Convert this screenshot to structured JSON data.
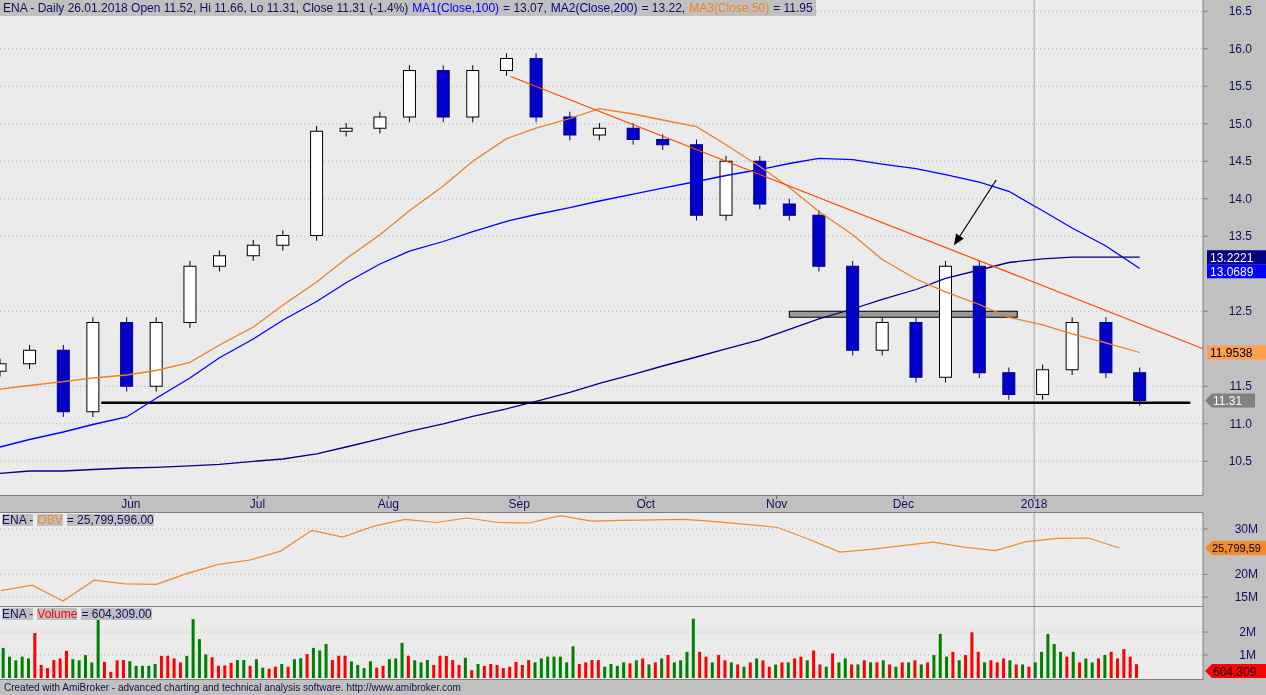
{
  "main": {
    "title": "ENA - Daily 26.01.2018 Open 11.52, Hi 11.66, Lo 11.31, Close 11.31 (-1.4%)",
    "readings": [
      "= 13.07,",
      "= 13.22,",
      "= 11.95"
    ],
    "value_tags": [
      {
        "text": "13.2221",
        "kind": "box",
        "color": "#000080"
      },
      {
        "text": "13.0689",
        "kind": "box",
        "color": "#0000ff"
      },
      {
        "text": "11.9538",
        "kind": "box",
        "color": "#ffa050"
      },
      {
        "text": "11.31",
        "kind": "arrow",
        "color": "#808080"
      }
    ],
    "chart_data": {
      "type": "candlestick",
      "grid": true,
      "ref_lines": [
        {
          "axis": "x",
          "value": "2018-01-01"
        },
        {
          "axis": "y",
          "value": 11.28
        }
      ],
      "bands": [
        {
          "axis": "y",
          "from": 12.42,
          "to": 12.5
        }
      ],
      "xlim": [
        "2017-05-01",
        "2018-02-10"
      ],
      "ylim": [
        10.05,
        16.65
      ],
      "yticks": [
        {
          "value": 10.5,
          "label": "10.5"
        },
        {
          "value": 11,
          "label": "11.0"
        },
        {
          "value": 11.5,
          "label": "11.5"
        },
        {
          "value": 12.5,
          "label": "12.5"
        },
        {
          "value": 13.5,
          "label": "13.5"
        },
        {
          "value": 14,
          "label": "14.0"
        },
        {
          "value": 14.5,
          "label": "14.5"
        },
        {
          "value": 15,
          "label": "15.0"
        },
        {
          "value": 15.5,
          "label": "15.5"
        },
        {
          "value": 16,
          "label": "16.0"
        },
        {
          "value": 16.5,
          "label": "16.5"
        }
      ],
      "xticks": [
        {
          "value": "2017-06-01",
          "label": "Jun"
        },
        {
          "value": "2017-07-01",
          "label": "Jul"
        },
        {
          "value": "2017-08-01",
          "label": "Aug"
        },
        {
          "value": "2017-09-01",
          "label": "Sep"
        },
        {
          "value": "2017-10-01",
          "label": "Oct"
        },
        {
          "value": "2017-11-01",
          "label": "Nov"
        },
        {
          "value": "2017-12-01",
          "label": "Dec"
        },
        {
          "value": "2018-01-01",
          "label": "2018"
        }
      ],
      "x": [
        "2017-05-01",
        "2017-05-08",
        "2017-05-16",
        "2017-05-23",
        "2017-05-31",
        "2017-06-07",
        "2017-06-15",
        "2017-06-22",
        "2017-06-30",
        "2017-07-07",
        "2017-07-15",
        "2017-07-22",
        "2017-07-30",
        "2017-08-06",
        "2017-08-14",
        "2017-08-21",
        "2017-08-29",
        "2017-09-05",
        "2017-09-13",
        "2017-09-20",
        "2017-09-28",
        "2017-10-05",
        "2017-10-13",
        "2017-10-20",
        "2017-10-28",
        "2017-11-04",
        "2017-11-11",
        "2017-11-19",
        "2017-11-26",
        "2017-12-04",
        "2017-12-11",
        "2017-12-19",
        "2017-12-26",
        "2018-01-03",
        "2018-01-10",
        "2018-01-18",
        "2018-01-26"
      ],
      "ohlc": [
        [
          11.7,
          11.87,
          11.63,
          11.8
        ],
        [
          11.8,
          12.05,
          11.73,
          11.98
        ],
        [
          11.98,
          12.05,
          11.09,
          11.16
        ],
        [
          11.16,
          12.42,
          11.09,
          12.35
        ],
        [
          12.35,
          12.42,
          11.43,
          11.5
        ],
        [
          11.5,
          12.42,
          11.43,
          12.35
        ],
        [
          12.35,
          13.17,
          12.28,
          13.1
        ],
        [
          13.1,
          13.31,
          13.03,
          13.24
        ],
        [
          13.24,
          13.45,
          13.17,
          13.38
        ],
        [
          13.38,
          13.58,
          13.31,
          13.51
        ],
        [
          13.51,
          14.97,
          13.44,
          14.9
        ],
        [
          14.9,
          15.01,
          14.83,
          14.94
        ],
        [
          14.94,
          15.16,
          14.87,
          15.09
        ],
        [
          15.09,
          15.78,
          15.02,
          15.71
        ],
        [
          15.71,
          15.78,
          15.02,
          15.09
        ],
        [
          15.09,
          15.78,
          15.02,
          15.71
        ],
        [
          15.71,
          15.94,
          15.64,
          15.87
        ],
        [
          15.87,
          15.94,
          15.02,
          15.09
        ],
        [
          15.09,
          15.16,
          14.78,
          14.85
        ],
        [
          14.85,
          15.01,
          14.78,
          14.94
        ],
        [
          14.94,
          15.01,
          14.72,
          14.79
        ],
        [
          14.79,
          14.86,
          14.65,
          14.72
        ],
        [
          14.72,
          14.79,
          13.71,
          13.78
        ],
        [
          13.78,
          14.57,
          13.71,
          14.5
        ],
        [
          14.5,
          14.57,
          13.86,
          13.93
        ],
        [
          13.93,
          14.0,
          13.71,
          13.78
        ],
        [
          13.78,
          13.85,
          13.03,
          13.1
        ],
        [
          13.1,
          13.17,
          11.91,
          11.98
        ],
        [
          11.98,
          12.42,
          11.91,
          12.35
        ],
        [
          12.35,
          12.42,
          11.55,
          11.62
        ],
        [
          11.62,
          13.17,
          11.55,
          13.1
        ],
        [
          13.1,
          13.17,
          11.61,
          11.68
        ],
        [
          11.68,
          11.75,
          11.32,
          11.39
        ],
        [
          11.39,
          11.79,
          11.32,
          11.72
        ],
        [
          11.72,
          12.42,
          11.65,
          12.35
        ],
        [
          12.35,
          12.42,
          11.61,
          11.68
        ],
        [
          11.68,
          11.75,
          11.24,
          11.31
        ]
      ],
      "series": [
        {
          "name": "MA1(Close,100)",
          "type": "line",
          "color": "#0000ff",
          "values": [
            10.69,
            10.79,
            10.89,
            10.99,
            11.09,
            11.34,
            11.61,
            11.88,
            12.13,
            12.38,
            12.63,
            12.88,
            13.13,
            13.3,
            13.43,
            13.56,
            13.7,
            13.79,
            13.88,
            13.97,
            14.06,
            14.14,
            14.23,
            14.31,
            14.39,
            14.47,
            14.54,
            14.52,
            14.46,
            14.4,
            14.32,
            14.22,
            14.1,
            13.84,
            13.61,
            13.37,
            13.07
          ]
        },
        {
          "name": "MA2(Close,200)",
          "type": "line",
          "color": "#000080",
          "values": [
            10.34,
            10.37,
            10.37,
            10.39,
            10.41,
            10.42,
            10.44,
            10.46,
            10.5,
            10.53,
            10.6,
            10.69,
            10.8,
            10.9,
            11.0,
            11.1,
            11.2,
            11.3,
            11.42,
            11.54,
            11.66,
            11.77,
            11.89,
            12.0,
            12.12,
            12.26,
            12.4,
            12.53,
            12.66,
            12.79,
            12.94,
            13.05,
            13.15,
            13.2,
            13.22,
            13.22,
            13.22
          ]
        },
        {
          "name": "MA3(Close,50)",
          "type": "line",
          "color": "#f08020",
          "values": [
            11.46,
            11.51,
            11.56,
            11.61,
            11.65,
            11.71,
            11.82,
            12.05,
            12.29,
            12.58,
            12.89,
            13.2,
            13.52,
            13.84,
            14.17,
            14.5,
            14.8,
            14.94,
            15.07,
            15.2,
            15.13,
            15.05,
            14.96,
            14.72,
            14.43,
            14.15,
            13.83,
            13.52,
            13.19,
            12.93,
            12.76,
            12.59,
            12.42,
            12.32,
            12.2,
            12.08,
            11.95
          ]
        }
      ]
    }
  },
  "obv_panel": {
    "prefix": "ENA -",
    "reading": "= 25,799,596.00",
    "tag": "25,799,59",
    "chart_data": {
      "type": "line",
      "grid": true,
      "ylim": [
        12.8,
        33.5
      ],
      "categories": [
        null,
        null,
        null,
        null,
        null,
        null,
        null,
        null,
        null,
        null,
        null,
        null,
        null,
        null,
        null,
        null,
        null,
        null,
        null,
        null,
        null,
        null,
        null,
        null,
        null,
        null,
        null,
        null,
        null,
        null,
        null,
        null,
        null,
        null,
        null,
        null,
        null
      ],
      "yticks": [
        {
          "value": 15,
          "label": "15M"
        },
        {
          "value": 20,
          "label": "20M"
        },
        {
          "value": 30,
          "label": "30M"
        }
      ],
      "series": [
        {
          "name": "OBV",
          "color": "#f28a2a",
          "values": [
            16.4,
            17.6,
            14.1,
            18.7,
            17.9,
            17.8,
            20.2,
            22.2,
            23.1,
            25.1,
            29.7,
            28.2,
            30.6,
            32.1,
            31.4,
            32.4,
            31.4,
            31.3,
            32.9,
            31.7,
            31.9,
            32.0,
            32.1,
            31.6,
            31.0,
            30.3,
            27.7,
            24.9,
            25.5,
            26.3,
            27.1,
            26.0,
            25.2,
            27.2,
            27.9,
            28.0,
            25.8
          ]
        }
      ]
    }
  },
  "volume_panel": {
    "prefix": "ENA -",
    "reading": "= 604,309.00",
    "tag": "604,309",
    "chart_data": {
      "type": "bar",
      "grid": true,
      "ylim": [
        0,
        3.09
      ],
      "categories": [
        null,
        null,
        null,
        null,
        null,
        null,
        null,
        null,
        null,
        null,
        null,
        null,
        null,
        null,
        null,
        null,
        null,
        null,
        null,
        null,
        null,
        null,
        null,
        null,
        null,
        null,
        null,
        null,
        null,
        null,
        null,
        null,
        null,
        null,
        null,
        null,
        null,
        null,
        null,
        null,
        null,
        null,
        null,
        null,
        null,
        null,
        null,
        null,
        null,
        null,
        null,
        null,
        null,
        null,
        null,
        null,
        null,
        null,
        null,
        null,
        null,
        null,
        null,
        null,
        null,
        null,
        null,
        null,
        null,
        null,
        null,
        null,
        null,
        null,
        null,
        null,
        null,
        null,
        null,
        null,
        null,
        null,
        null,
        null,
        null,
        null,
        null,
        null,
        null,
        null,
        null,
        null,
        null,
        null,
        null,
        null,
        null,
        null,
        null,
        null,
        null,
        null,
        null,
        null,
        null,
        null,
        null,
        null,
        null,
        null,
        null,
        null,
        null,
        null,
        null,
        null,
        null,
        null,
        null,
        null,
        null,
        null,
        null,
        null,
        null,
        null,
        null,
        null,
        null,
        null,
        null,
        null,
        null,
        null,
        null,
        null,
        null,
        null,
        null,
        null,
        null,
        null,
        null,
        null,
        null,
        null,
        null,
        null,
        null,
        null,
        null,
        null,
        null,
        null,
        null,
        null,
        null,
        null,
        null,
        null,
        null,
        null,
        null,
        null,
        null,
        null,
        null,
        null,
        null,
        null,
        null,
        null,
        null,
        null,
        null,
        null,
        null,
        null,
        null,
        null,
        null,
        null,
        null,
        null,
        null,
        null,
        null,
        null,
        null,
        null
      ],
      "yticks": [
        {
          "value": 1,
          "label": "1M"
        },
        {
          "value": 2,
          "label": "2M"
        }
      ],
      "series": [
        {
          "color": "#008000",
          "values": [
            1.31,
            0.93,
            0.77,
            0.93,
            0.85,
            null,
            null,
            null,
            null,
            null,
            null,
            0.82,
            0.77,
            1.0,
            0.68,
            2.52,
            null,
            null,
            null,
            null,
            0.73,
            0.53,
            0.53,
            0.53,
            0.61,
            null,
            null,
            null,
            null,
            0.96,
            2.56,
            1.69,
            1.03,
            null,
            null,
            null,
            null,
            0.78,
            0.78,
            null,
            0.82,
            0.45,
            null,
            null,
            0.61,
            null,
            0.82,
            0.86,
            null,
            1.31,
            1.2,
            1.48,
            null,
            null,
            null,
            0.72,
            0.57,
            0.43,
            0.73,
            null,
            null,
            0.82,
            0.85,
            1.53,
            null,
            0.77,
            0.68,
            0.78,
            null,
            null,
            null,
            null,
            null,
            0.88,
            null,
            0.61,
            null,
            null,
            null,
            null,
            null,
            null,
            null,
            null,
            0.68,
            0.85,
            0.93,
            0.93,
            0.93,
            0.68,
            1.38,
            null,
            null,
            null,
            null,
            0.49,
            0.61,
            0.53,
            0.68,
            null,
            0.77,
            null,
            0.59,
            null,
            0.85,
            null,
            0.68,
            0.77,
            1.14,
            2.58,
            null,
            null,
            0.68,
            null,
            null,
            0.68,
            null,
            0.49,
            null,
            0.85,
            null,
            null,
            0.59,
            null,
            0.68,
            null,
            null,
            0.77,
            null,
            null,
            0.49,
            null,
            0.68,
            0.85,
            null,
            0.59,
            null,
            0.68,
            null,
            0.77,
            null,
            0.49,
            null,
            0.68,
            null,
            0.59,
            null,
            1.0,
            1.92,
            0.93,
            null,
            0.77,
            null,
            null,
            null,
            0.68,
            null,
            null,
            null,
            0.77,
            null,
            0.59,
            null,
            0.68,
            1.14,
            1.92,
            1.48,
            1.14,
            null,
            1.14,
            null,
            0.85,
            0.68,
            null,
            1.0,
            null,
            null,
            null,
            null,
            null,
            null,
            null,
            null,
            null,
            null,
            null,
            null,
            null,
            null,
            null
          ]
        },
        {
          "name": "Volume",
          "color": "#ff0000",
          "values": [
            null,
            null,
            null,
            null,
            null,
            1.96,
            0.57,
            0.43,
            0.78,
            0.85,
            1.18,
            null,
            null,
            null,
            null,
            null,
            0.7,
            0.27,
            0.77,
            0.78,
            null,
            null,
            null,
            null,
            null,
            0.96,
            0.97,
            0.85,
            0.68,
            null,
            null,
            null,
            null,
            0.9,
            0.53,
            0.55,
            0.66,
            null,
            null,
            0.53,
            null,
            null,
            0.4,
            0.49,
            null,
            0.49,
            null,
            null,
            1.04,
            null,
            null,
            null,
            0.78,
            0.97,
            0.97,
            null,
            null,
            null,
            null,
            0.45,
            0.53,
            null,
            null,
            null,
            0.97,
            null,
            null,
            null,
            0.57,
            0.97,
            0.96,
            0.78,
            0.57,
            null,
            0.34,
            null,
            0.53,
            0.61,
            0.57,
            0.43,
            0.49,
            0.7,
            0.57,
            0.78,
            null,
            null,
            null,
            null,
            null,
            null,
            null,
            0.61,
            0.68,
            0.78,
            0.78,
            null,
            null,
            null,
            null,
            0.64,
            null,
            0.85,
            null,
            0.68,
            null,
            1.0,
            null,
            null,
            null,
            null,
            1.14,
            0.93,
            null,
            1.0,
            0.77,
            null,
            0.59,
            null,
            0.68,
            null,
            0.77,
            0.49,
            null,
            0.68,
            null,
            0.85,
            0.93,
            null,
            1.2,
            0.59,
            null,
            1.07,
            null,
            null,
            0.59,
            null,
            0.77,
            null,
            0.68,
            null,
            0.59,
            null,
            0.68,
            null,
            0.77,
            null,
            0.68,
            null,
            null,
            null,
            1.14,
            null,
            1.0,
            1.99,
            1.14,
            null,
            0.77,
            0.68,
            0.85,
            null,
            0.59,
            null,
            0.49,
            null,
            null,
            null,
            null,
            null,
            0.93,
            null,
            0.68,
            null,
            null,
            0.85,
            null,
            1.14,
            0.85,
            1.26,
            0.93,
            0.6,
            null,
            null,
            null,
            null,
            null,
            null,
            null,
            null,
            null,
            null
          ]
        }
      ]
    }
  },
  "footer": "Created with AmiBroker - advanced charting and technical analysis software. http://www.amibroker.com"
}
